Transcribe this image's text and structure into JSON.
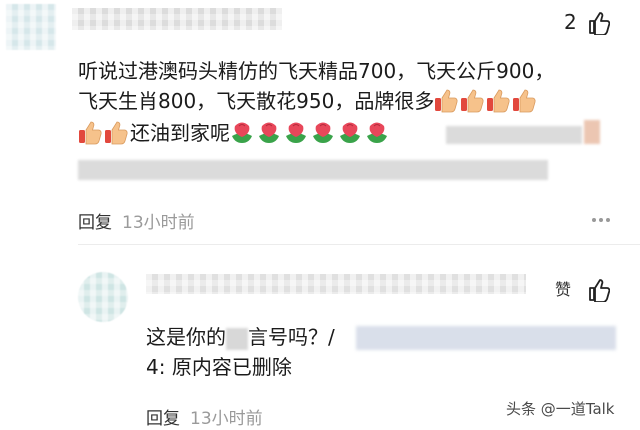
{
  "comment": {
    "like_count": "2",
    "lines": [
      "听说过港澳码头精仿的飞天精品700，飞天公斤900，",
      "飞天生肖800，飞天散花950，品牌很多",
      "还油到家呢"
    ],
    "reply_label": "回复",
    "time": "13小时前"
  },
  "reply": {
    "author_tag": "赞",
    "text_before": "这是你的",
    "text_after": "言号吗？/",
    "line2": "4:  原内容已删除",
    "reply_label": "回复",
    "time": "13小时前"
  },
  "watermark": "头条 @一道Talk",
  "colors": {
    "thumb_fill": "#f6c28b",
    "thumb_cuff": "#e2483d",
    "flower_red": "#e8475a",
    "flower_leaf": "#3aa34a"
  }
}
